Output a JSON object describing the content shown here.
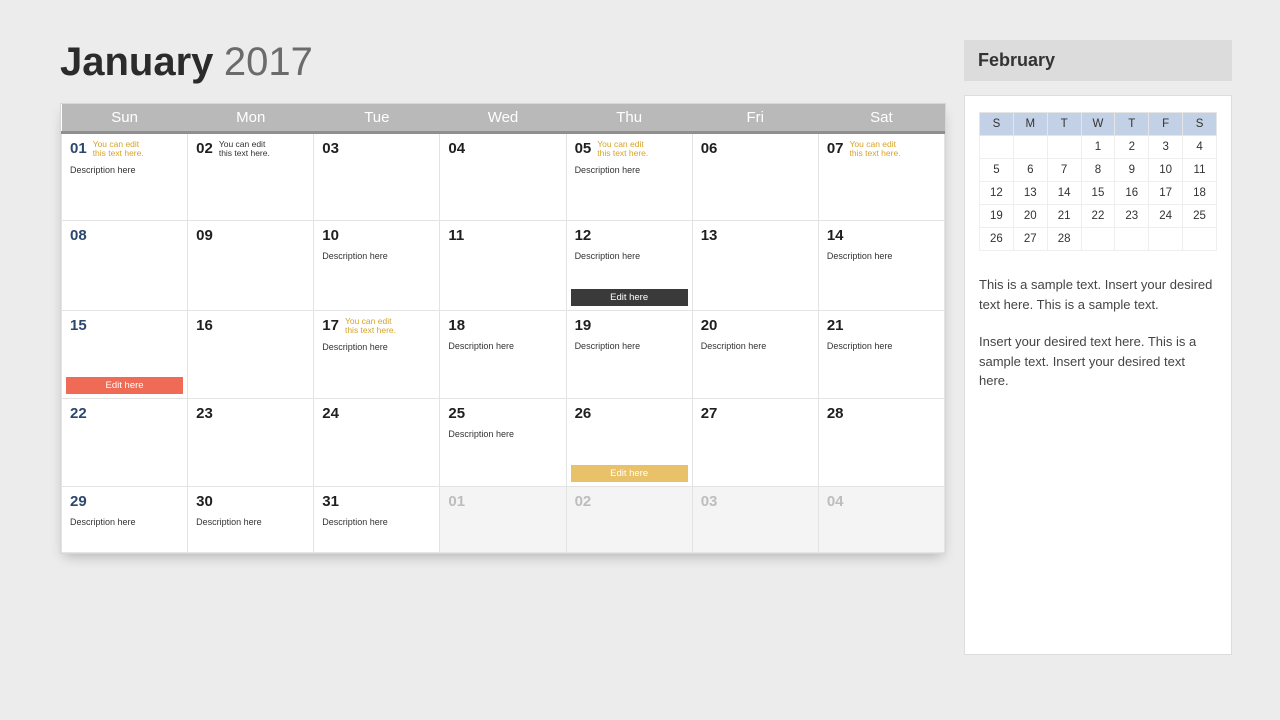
{
  "title": {
    "month": "January",
    "year": "2017"
  },
  "weekdays": [
    "Sun",
    "Mon",
    "Tue",
    "Wed",
    "Thu",
    "Fri",
    "Sat"
  ],
  "note_text": "You can edit this text here.",
  "desc_text": "Description here",
  "tag_text": "Edit here",
  "weeks": [
    [
      {
        "n": "01",
        "sun": true,
        "note": "gold",
        "desc": true
      },
      {
        "n": "02",
        "note": "dark"
      },
      {
        "n": "03"
      },
      {
        "n": "04"
      },
      {
        "n": "05",
        "note": "gold",
        "desc": true
      },
      {
        "n": "06"
      },
      {
        "n": "07",
        "note": "gold"
      }
    ],
    [
      {
        "n": "08",
        "sun": true
      },
      {
        "n": "09"
      },
      {
        "n": "10",
        "desc": true
      },
      {
        "n": "11"
      },
      {
        "n": "12",
        "desc": true,
        "tag": "dark"
      },
      {
        "n": "13"
      },
      {
        "n": "14",
        "desc": true
      }
    ],
    [
      {
        "n": "15",
        "sun": true,
        "tag": "red"
      },
      {
        "n": "16"
      },
      {
        "n": "17",
        "note": "gold",
        "desc": true
      },
      {
        "n": "18",
        "desc": true
      },
      {
        "n": "19",
        "desc": true
      },
      {
        "n": "20",
        "desc": true
      },
      {
        "n": "21",
        "desc": true
      }
    ],
    [
      {
        "n": "22",
        "sun": true
      },
      {
        "n": "23"
      },
      {
        "n": "24"
      },
      {
        "n": "25",
        "desc": true
      },
      {
        "n": "26",
        "tag": "yellow"
      },
      {
        "n": "27"
      },
      {
        "n": "28"
      }
    ],
    [
      {
        "n": "29",
        "sun": true,
        "in": true,
        "desc": true
      },
      {
        "n": "30",
        "in": true,
        "desc": true
      },
      {
        "n": "31",
        "in": true,
        "desc": true
      },
      {
        "n": "01",
        "out": true
      },
      {
        "n": "02",
        "out": true
      },
      {
        "n": "03",
        "out": true
      },
      {
        "n": "04",
        "out": true
      }
    ]
  ],
  "side": {
    "title": "February",
    "weekdays": [
      "S",
      "M",
      "T",
      "W",
      "T",
      "F",
      "S"
    ],
    "rows": [
      [
        "",
        "",
        "",
        "1",
        "2",
        "3",
        "4"
      ],
      [
        "5",
        "6",
        "7",
        "8",
        "9",
        "10",
        "11"
      ],
      [
        "12",
        "13",
        "14",
        "15",
        "16",
        "17",
        "18"
      ],
      [
        "19",
        "20",
        "21",
        "22",
        "23",
        "24",
        "25"
      ],
      [
        "26",
        "27",
        "28",
        "",
        "",
        "",
        ""
      ]
    ],
    "para1": "This is a sample text. Insert your desired text here. This is a sample text.",
    "para2": "Insert your desired text here. This is a sample text. Insert your desired text here."
  }
}
